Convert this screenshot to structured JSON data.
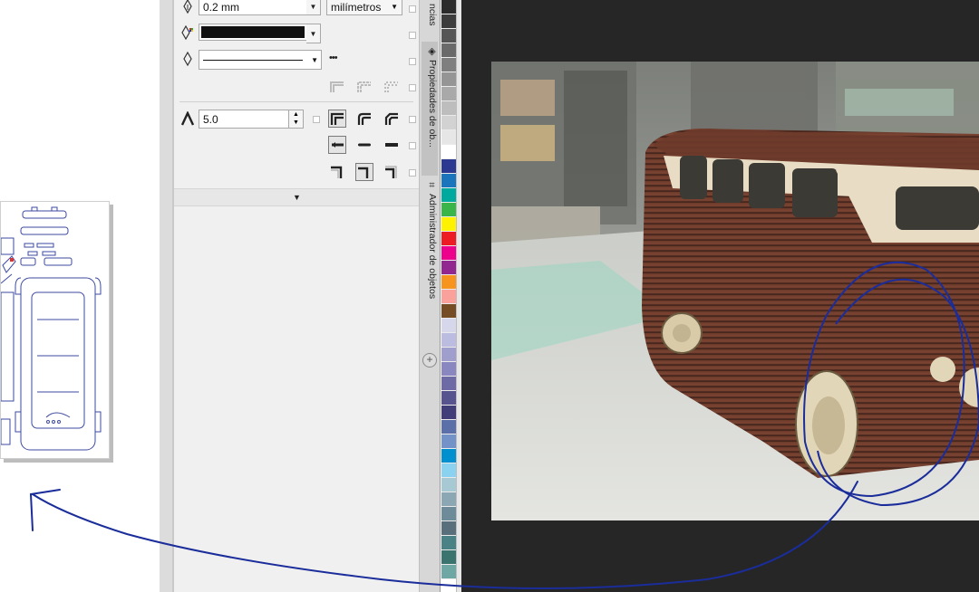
{
  "outline": {
    "width_value": "0.2 mm",
    "units_value": "milímetros",
    "color_swatch": "#111111",
    "style_label": "solid-line",
    "more_dots": "•••"
  },
  "miter": {
    "value": "5.0"
  },
  "docker": {
    "tab_top_label": "ncias",
    "tab_properties_label": "Propiedades de ob...",
    "tab_objects_label": "Administrador de objetos"
  },
  "palette": {
    "colors": [
      "#2b2b2b",
      "#3c3c3c",
      "#555555",
      "#6a6a6a",
      "#7f7f7f",
      "#959595",
      "#a9a9a9",
      "#bdbdbd",
      "#d2d2d2",
      "#e6e6e6",
      "#ffffff",
      "#2b3990",
      "#1b75bc",
      "#00a99d",
      "#39b54a",
      "#fff200",
      "#ed1c24",
      "#ec008c",
      "#92278f",
      "#f7941d",
      "#f9a19a",
      "#754c24",
      "#d7d7eb",
      "#bcbce0",
      "#a09ecd",
      "#8a87c0",
      "#6d6aa6",
      "#57538f",
      "#403d78",
      "#5b6fa8",
      "#7392c7",
      "#0090d0",
      "#8ad2ef",
      "#a7c9d3",
      "#8aa7b3",
      "#6d8b98",
      "#596f7c",
      "#4a8286",
      "#3b736f",
      "#6fa7a4"
    ]
  },
  "colors": {
    "panel_bg": "#f0f0f0",
    "workspace_bg": "#262626",
    "arrow_blue": "#1a2d9a"
  }
}
